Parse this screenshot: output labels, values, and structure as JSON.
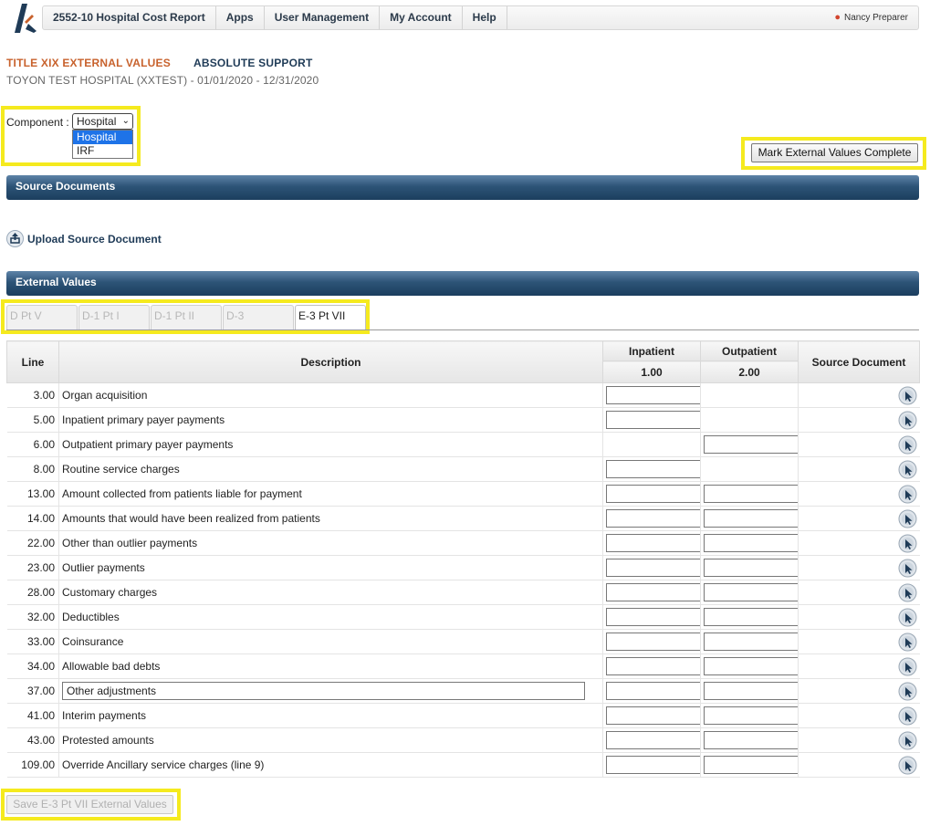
{
  "nav": {
    "items": [
      "2552-10 Hospital Cost Report",
      "Apps",
      "User Management",
      "My Account",
      "Help"
    ],
    "user": "Nancy Preparer"
  },
  "header": {
    "title": "TITLE XIX EXTERNAL VALUES",
    "support": "ABSOLUTE SUPPORT",
    "subtitle": "TOYON TEST HOSPITAL (XXTEST)  -  01/01/2020 - 12/31/2020"
  },
  "component": {
    "label": "Component :",
    "selected": "Hospital",
    "options": [
      "Hospital",
      "IRF"
    ]
  },
  "mark_complete_label": "Mark External Values Complete",
  "sections": {
    "source_documents": "Source Documents",
    "external_values": "External Values"
  },
  "upload_label": "Upload Source Document",
  "tabs": [
    "D Pt V",
    "D-1 Pt I",
    "D-1 Pt II",
    "D-3",
    "E-3 Pt VII"
  ],
  "table": {
    "headers": {
      "line": "Line",
      "description": "Description",
      "inpatient": "Inpatient",
      "outpatient": "Outpatient",
      "inpatient_col": "1.00",
      "outpatient_col": "2.00",
      "source": "Source Document"
    },
    "rows": [
      {
        "line": "3.00",
        "desc": "Organ acquisition",
        "inp": true,
        "outp": false
      },
      {
        "line": "5.00",
        "desc": "Inpatient primary payer payments",
        "inp": true,
        "outp": false
      },
      {
        "line": "6.00",
        "desc": "Outpatient primary payer payments",
        "inp": false,
        "outp": true
      },
      {
        "line": "8.00",
        "desc": "Routine service charges",
        "inp": true,
        "outp": false
      },
      {
        "line": "13.00",
        "desc": "Amount collected from patients liable for payment",
        "inp": true,
        "outp": true
      },
      {
        "line": "14.00",
        "desc": "Amounts that would have been realized from patients",
        "inp": true,
        "outp": true
      },
      {
        "line": "22.00",
        "desc": "Other than outlier payments",
        "inp": true,
        "outp": true
      },
      {
        "line": "23.00",
        "desc": "Outlier payments",
        "inp": true,
        "outp": true
      },
      {
        "line": "28.00",
        "desc": "Customary charges",
        "inp": true,
        "outp": true
      },
      {
        "line": "32.00",
        "desc": "Deductibles",
        "inp": true,
        "outp": true
      },
      {
        "line": "33.00",
        "desc": "Coinsurance",
        "inp": true,
        "outp": true
      },
      {
        "line": "34.00",
        "desc": "Allowable bad debts",
        "inp": true,
        "outp": true
      },
      {
        "line": "37.00",
        "desc": "Other adjustments",
        "inp": true,
        "outp": true,
        "desc_input": true
      },
      {
        "line": "41.00",
        "desc": "Interim payments",
        "inp": true,
        "outp": true
      },
      {
        "line": "43.00",
        "desc": "Protested amounts",
        "inp": true,
        "outp": true
      },
      {
        "line": "109.00",
        "desc": "Override Ancillary service charges (line 9)",
        "inp": true,
        "outp": true
      }
    ]
  },
  "save_label": "Save E-3 Pt VII External Values",
  "colors": {
    "accent_title": "#c8622d",
    "navy": "#1f3b57",
    "highlight": "#f5ea1e",
    "select_blue": "#1e73e8"
  }
}
